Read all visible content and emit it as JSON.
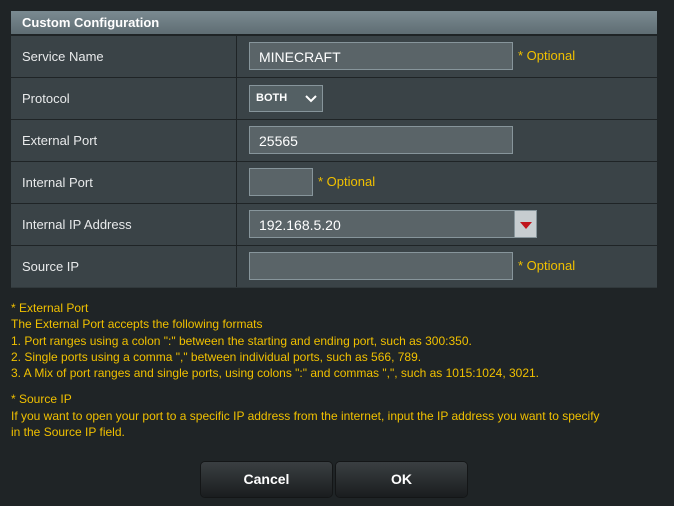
{
  "header": {
    "title": "Custom Configuration"
  },
  "fields": {
    "service_name": {
      "label": "Service Name",
      "value": "MINECRAFT",
      "optional": "* Optional"
    },
    "protocol": {
      "label": "Protocol",
      "value": "BOTH"
    },
    "external_port": {
      "label": "External Port",
      "value": "25565"
    },
    "internal_port": {
      "label": "Internal Port",
      "value": "",
      "optional": "* Optional"
    },
    "internal_ip": {
      "label": "Internal IP Address",
      "value": "192.168.5.20"
    },
    "source_ip": {
      "label": "Source IP",
      "value": "",
      "optional": "* Optional"
    }
  },
  "notes": {
    "external_title": "* External Port",
    "external_intro": "The External Port accepts the following formats",
    "external_1": "1. Port ranges using a colon \":\" between the starting and ending port, such as 300:350.",
    "external_2": "2. Single ports using a comma \",\" between individual ports, such as 566, 789.",
    "external_3": "3. A Mix of port ranges and single ports, using colons \":\" and commas \",\", such as 1015:1024, 3021.",
    "source_title": "* Source IP",
    "source_1": "If you want to open your port to a specific IP address from the internet, input the IP address you want to specify",
    "source_2": "in the Source IP field."
  },
  "buttons": {
    "cancel": "Cancel",
    "ok": "OK"
  },
  "icons": {
    "protocol_dropdown": "chevron-down-icon",
    "ip_dropdown": "triangle-down-icon"
  },
  "colors": {
    "optional_text": "#f0c000",
    "header_bg": "#6f7f86",
    "dropdown_arrow": "#c0141c"
  }
}
